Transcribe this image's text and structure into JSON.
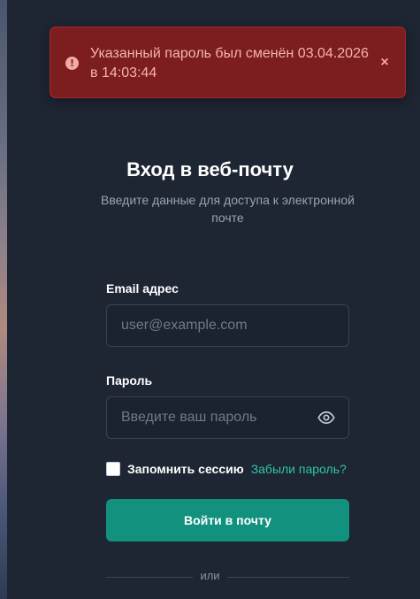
{
  "toast": {
    "message": "Указанный пароль был сменён 03.04.2026 в 14:03:44",
    "icon": "alert-circle-icon",
    "close_label": "×",
    "bg_color": "#7c1d1f",
    "text_color": "#f6b4ad"
  },
  "login": {
    "title": "Вход в веб-почту",
    "subtitle": "Введите данные для доступа к электронной почте",
    "email_label": "Email адрес",
    "email_placeholder": "user@example.com",
    "email_value": "",
    "password_label": "Пароль",
    "password_placeholder": "Введите ваш пароль",
    "password_value": "",
    "remember_label": "Запомнить сессию",
    "remember_checked": false,
    "forgot_link": "Забыли пароль?",
    "submit_label": "Войти в почту",
    "divider_label": "или",
    "accent_color": "#12917f",
    "link_color": "#2bc7a8"
  }
}
